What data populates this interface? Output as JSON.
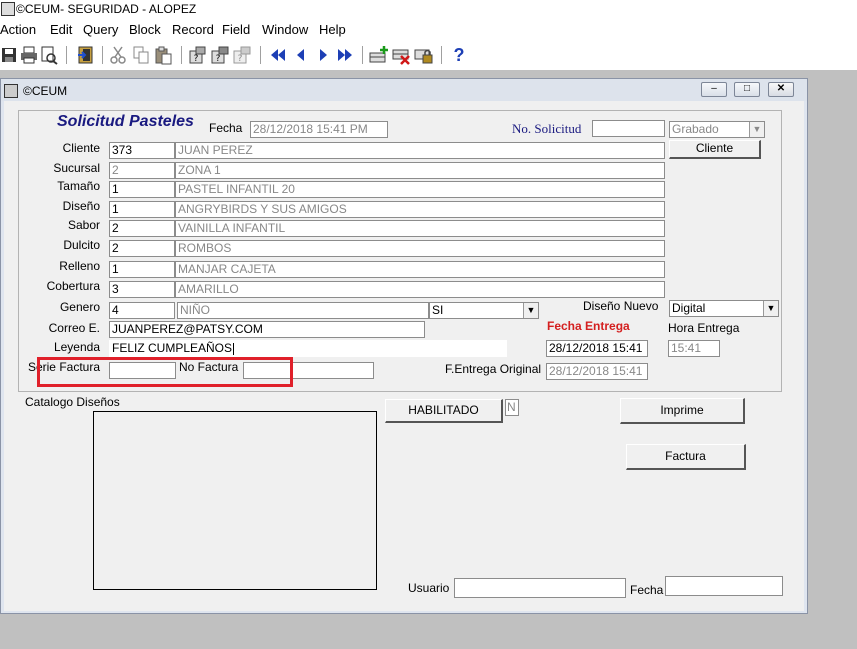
{
  "app": {
    "title": "©CEUM- SEGURIDAD - ALOPEZ"
  },
  "menu": [
    "Action",
    "Edit",
    "Query",
    "Block",
    "Record",
    "Field",
    "Window",
    "Help"
  ],
  "toolbar": {
    "icons": [
      "save-icon",
      "print-icon",
      "print-preview-icon",
      "exit-icon",
      "cut-icon",
      "copy-icon",
      "paste-icon",
      "enter-query-icon",
      "execute-query-icon",
      "cancel-query-icon",
      "first-record-icon",
      "previous-record-icon",
      "next-record-icon",
      "last-record-icon",
      "insert-record-icon",
      "delete-record-icon",
      "lock-record-icon",
      "help-icon"
    ],
    "help_glyph": "?"
  },
  "window": {
    "title": "©CEUM"
  },
  "form": {
    "heading": "Solicitud Pasteles",
    "fecha_label": "Fecha",
    "fecha_value": "28/12/2018 15:41 PM",
    "nosol_label": "No. Solicitud",
    "nosol_value": "",
    "status_value": "Grabado",
    "cliente_button": "Cliente",
    "rows": [
      {
        "label": "Cliente",
        "code": "373",
        "desc": "JUAN PEREZ"
      },
      {
        "label": "Sucursal",
        "code": "2",
        "desc": "ZONA 1"
      },
      {
        "label": "Tamaño",
        "code": "1",
        "desc": "PASTEL INFANTIL 20"
      },
      {
        "label": "Diseño",
        "code": "1",
        "desc": "ANGRYBIRDS Y SUS AMIGOS"
      },
      {
        "label": "Sabor",
        "code": "2",
        "desc": "VAINILLA INFANTIL"
      },
      {
        "label": "Dulcito",
        "code": "2",
        "desc": "ROMBOS"
      },
      {
        "label": "Relleno",
        "code": "1",
        "desc": "MANJAR CAJETA"
      },
      {
        "label": "Cobertura",
        "code": "3",
        "desc": "AMARILLO"
      }
    ],
    "genero_label": "Genero",
    "genero_code": "4",
    "genero_desc": "NIÑO",
    "genero_si": "SI",
    "diseno_nuevo_label": "Diseño Nuevo",
    "diseno_nuevo_value": "Digital",
    "correo_label": "Correo E.",
    "correo_value": "JUANPEREZ@PATSY.COM",
    "fecha_entrega_label": "Fecha Entrega",
    "hora_entrega_label": "Hora Entrega",
    "leyenda_label": "Leyenda",
    "leyenda_value": "FELIZ CUMPLEAÑOS",
    "fecha_entrega_value": "28/12/2018 15:41",
    "hora_entrega_value": "15:41",
    "serie_factura_label": "Serie Factura",
    "no_factura_label": "No Factura",
    "fentrega_orig_label": "F.Entrega Original",
    "fentrega_orig_value": "28/12/2018 15:41",
    "catalogo_label": "Catalogo Diseños",
    "habilitado_button": "HABILITADO",
    "habilitado_value": "N",
    "imprime_button": "Imprime",
    "factura_button": "Factura",
    "usuario_label": "Usuario",
    "fecha2_label": "Fecha",
    "highlight_color": "#e0202a",
    "heading_color": "#1a1a80",
    "accent_red": "#d42020"
  }
}
